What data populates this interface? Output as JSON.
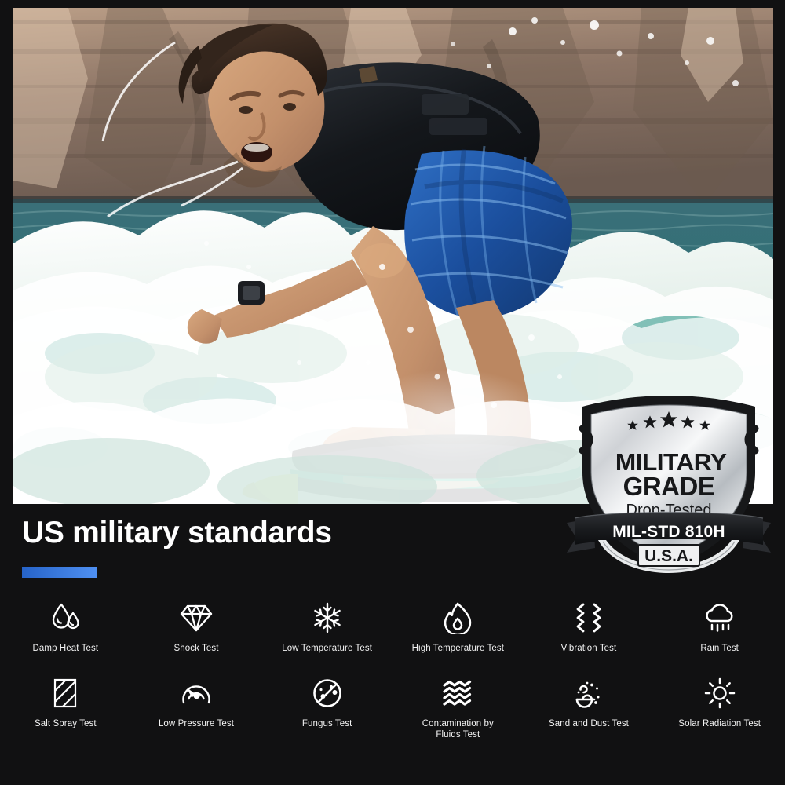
{
  "page": {
    "background_color": "#111112",
    "accent_color_start": "#2663c8",
    "accent_color_end": "#4f90f2"
  },
  "hero": {
    "name": "wakesurfing-hero-photo",
    "alt": "Man wakesurfing on a green-blue lake wave in front of a sandstone cliff, wearing a black life vest and blue plaid board shorts, riding a dark board with teal and yellow accents",
    "scene": {
      "cliff_color": "#8d7566",
      "water_color": "#2f6f74",
      "foam_color": "#f2f5f3",
      "vest_color": "#16181c",
      "shorts_color": "#1c55a8",
      "board_color": "#23282b",
      "board_accent_teal": "#19b08c",
      "board_accent_yellow": "#e8e21a",
      "skin_color": "#c99673",
      "hair_color": "#3a2a20"
    }
  },
  "badge": {
    "name": "military-grade-badge",
    "stars_count": 5,
    "title_line1": "MILITARY",
    "title_line2": "GRADE",
    "subtitle": "Drop-Tested",
    "ribbon_text": "MIL-STD 810H",
    "footer_text": "U.S.A.",
    "shield_color_light": "#e9eaec",
    "shield_color_dark": "#9ea3a8",
    "outline_color": "#17181a",
    "ribbon_color": "#1b1c1e"
  },
  "heading": {
    "title": "US military standards"
  },
  "tests": [
    {
      "label": "Damp Heat Test",
      "icon": "water-drops-icon"
    },
    {
      "label": "Shock Test",
      "icon": "diamond-icon"
    },
    {
      "label": "Low Temperature Test",
      "icon": "snowflake-icon"
    },
    {
      "label": "High Temperature Test",
      "icon": "flame-icon"
    },
    {
      "label": "Vibration Test",
      "icon": "vibration-zigzag-icon"
    },
    {
      "label": "Rain Test",
      "icon": "rain-cloud-icon"
    },
    {
      "label": "Salt Spray Test",
      "icon": "hatched-square-icon"
    },
    {
      "label": "Low Pressure Test",
      "icon": "gauge-icon"
    },
    {
      "label": "Fungus Test",
      "icon": "fungus-no-icon"
    },
    {
      "label": "Contamination by\nFluids Test",
      "icon": "waves-icon"
    },
    {
      "label": "Sand and Dust Test",
      "icon": "sand-dust-swirl-icon"
    },
    {
      "label": "Solar Radiation Test",
      "icon": "sun-icon"
    }
  ]
}
